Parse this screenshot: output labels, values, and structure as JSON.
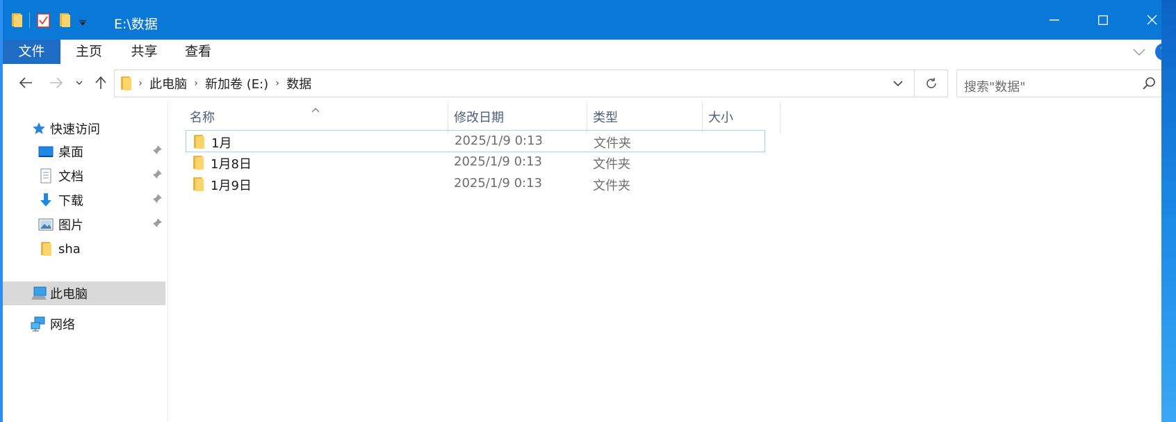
{
  "window": {
    "title": "E:\\数据",
    "colors": {
      "titlebar": "#0a78d7",
      "file_tab": "#1f6cc4",
      "selection": "#d9d9d9",
      "focus_border": "#99d1ff"
    }
  },
  "ribbon": {
    "tabs": [
      {
        "label": "文件"
      },
      {
        "label": "主页"
      },
      {
        "label": "共享"
      },
      {
        "label": "查看"
      }
    ],
    "help_label": "?"
  },
  "address": {
    "crumbs": [
      "此电脑",
      "新加卷 (E:)",
      "数据"
    ],
    "search_placeholder": "搜索\"数据\""
  },
  "sidebar": {
    "quick_access": "快速访问",
    "items": [
      {
        "label": "桌面",
        "icon": "desktop-icon",
        "pinned": true
      },
      {
        "label": "文档",
        "icon": "documents-icon",
        "pinned": true
      },
      {
        "label": "下载",
        "icon": "download-icon",
        "pinned": true
      },
      {
        "label": "图片",
        "icon": "pictures-icon",
        "pinned": true
      },
      {
        "label": "sha",
        "icon": "folder-icon",
        "pinned": false
      }
    ],
    "this_pc": "此电脑",
    "network": "网络"
  },
  "file_list": {
    "columns": [
      "名称",
      "修改日期",
      "类型",
      "大小"
    ],
    "rows": [
      {
        "name": "1月",
        "modified": "2025/1/9 0:13",
        "type": "文件夹",
        "size": ""
      },
      {
        "name": "1月8日",
        "modified": "2025/1/9 0:13",
        "type": "文件夹",
        "size": ""
      },
      {
        "name": "1月9日",
        "modified": "2025/1/9 0:13",
        "type": "文件夹",
        "size": ""
      }
    ]
  }
}
